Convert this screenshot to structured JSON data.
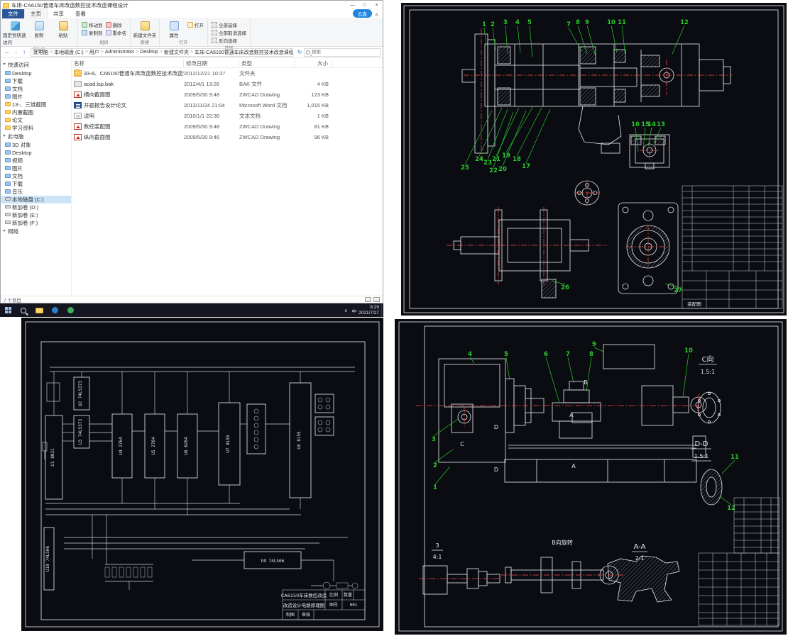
{
  "icons": {
    "back": "←",
    "forward": "→",
    "up": "↑",
    "refresh": "↻",
    "chevron": ">",
    "collapse": "∧"
  },
  "explorer": {
    "titlebar": {
      "title": "车床-CA6150普通车床改造数控技术改造课程设计",
      "min": "—",
      "max": "□",
      "close": "×"
    },
    "tabs": {
      "file": "文件",
      "home": "主页",
      "share": "共享",
      "view": "查看",
      "cloud": "云盘"
    },
    "ribbon": {
      "pin": "固定到快速访问",
      "copy": "复制",
      "paste": "粘贴",
      "move_to": "移动到",
      "copy_to": "复制到",
      "delete": "删除",
      "rename": "重命名",
      "new_folder": "新建文件夹",
      "properties": "属性",
      "open": "打开",
      "select_all": "全部选择",
      "select_none": "全部取消选择",
      "invert": "反向选择",
      "g_clipboard": "剪贴板",
      "g_organize": "组织",
      "g_new": "新建",
      "g_open": "打开",
      "g_select": "选择"
    },
    "address": [
      "此电脑",
      "本地磁盘 (C:)",
      "用户",
      "Administrator",
      "Desktop",
      "新建文件夹",
      "车床-CA6150普通车床改造数控技术改造课程设计"
    ],
    "search_placeholder": "搜索",
    "columns": [
      "名称",
      "修改日期",
      "类型",
      "大小"
    ],
    "files": [
      {
        "name": "33-8、CA6150普通车床改造数控技术改造课程设计",
        "date": "2012/12/21 10:37",
        "type": "文件夹",
        "size": ""
      },
      {
        "name": "acad.lsp.bak",
        "date": "2012/4/1 13:26",
        "type": "BAK 文件",
        "size": "4 KB"
      },
      {
        "name": "横向截面图",
        "date": "2009/5/30 9:48",
        "type": "ZWCAD Drawing",
        "size": "123 KB"
      },
      {
        "name": "开题报告设计论文",
        "date": "2013/11/24 21:04",
        "type": "Microsoft Word 文档",
        "size": "1,015 KB"
      },
      {
        "name": "说明",
        "date": "2010/1/1 22:36",
        "type": "文本文档",
        "size": "1 KB"
      },
      {
        "name": "数控装配图",
        "date": "2009/5/30 9:48",
        "type": "ZWCAD Drawing",
        "size": "81 KB"
      },
      {
        "name": "纵向截面图",
        "date": "2009/5/30 9:46",
        "type": "ZWCAD Drawing",
        "size": "96 KB"
      }
    ],
    "sidebar": {
      "quick_header": "快速访问",
      "quick": [
        "Desktop",
        "下载",
        "文档",
        "图片",
        "13-、三维截图",
        "内置截图",
        "论文",
        "学习资料"
      ],
      "pc_header": "此电脑",
      "pc": [
        "3D 对象",
        "Desktop",
        "视频",
        "图片",
        "文档",
        "下载",
        "音乐",
        "本地磁盘 (C:)",
        "新加卷 (D:)",
        "新加卷 (E:)",
        "新加卷 (F:)"
      ],
      "network": "网络"
    },
    "status": "7 个项目"
  },
  "taskbar": {
    "ime": "中",
    "time": "8:29",
    "date": "2021/7/27"
  },
  "cad1": {
    "callouts": [
      "1",
      "2",
      "3",
      "4",
      "5",
      "7",
      "8",
      "9",
      "10",
      "11",
      "12",
      "13",
      "14",
      "15",
      "16",
      "17",
      "18",
      "19",
      "20",
      "21",
      "22",
      "23",
      "24",
      "25",
      "26",
      "27"
    ],
    "title_block_label": "装配图"
  },
  "circuit": {
    "ics": {
      "u1": "U1 8031",
      "u2": "U2 74LS373",
      "u3": "U3 74LS373",
      "u4": "U4 2764",
      "u5": "U5 2764",
      "u6": "U6 6264",
      "u7": "U7 8155",
      "u8": "U8 8155",
      "u9": "U9 74LS06",
      "u10": "U10 74LS06"
    },
    "title_block": {
      "line1": "CA6150车床数控改造",
      "line2": "改造设计电路原理图",
      "scale_label": "比例",
      "qty_label": "数量",
      "no_label": "图号",
      "no_value": "001",
      "draw": "制图",
      "check": "审核"
    }
  },
  "cad2": {
    "callouts": [
      "1",
      "2",
      "3",
      "4",
      "5",
      "6",
      "7",
      "8",
      "9",
      "10",
      "11",
      "12"
    ],
    "views": {
      "c_label": "C向",
      "c_scale": "1.5:1",
      "dd_label": "D-D",
      "dd_scale": "1.5:1",
      "b_label": "B向旋转",
      "aa_label": "A-A",
      "aa_scale": "2:1",
      "v3_num": "3",
      "v3_scale": "4:1"
    },
    "marks": {
      "a": "A",
      "b": "B",
      "c": "C",
      "d": "D"
    }
  }
}
